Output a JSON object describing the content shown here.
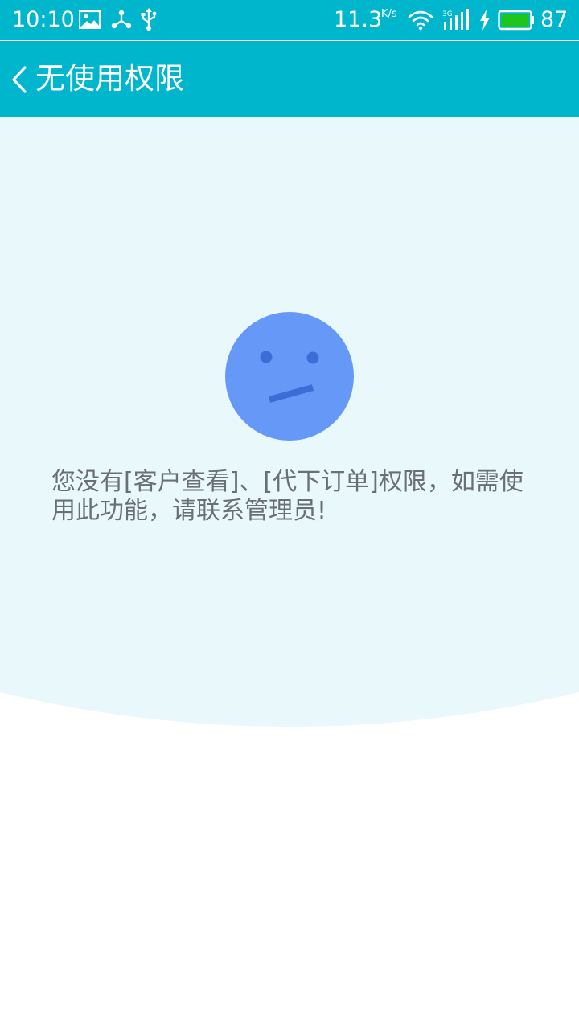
{
  "status_bar": {
    "time": "10:10",
    "net_speed": "11.3",
    "net_speed_unit": "K/s",
    "signal_type": "3G",
    "battery_level": "87",
    "icons": [
      "image-icon",
      "share-node-icon",
      "usb-icon",
      "wifi-icon",
      "signal-icon",
      "charging-icon",
      "battery-icon"
    ],
    "battery_color": "#1ec51e"
  },
  "header": {
    "back_icon": "chevron-left-icon",
    "title": "无使用权限"
  },
  "main": {
    "illustration": "neutral-face-icon",
    "message": "您没有[客户查看]、[代下订单]权限，如需使用此功能，请联系管理员!"
  },
  "colors": {
    "primary": "#00b6cd",
    "background_arc": "#e8f8fb",
    "face": "#6598f7",
    "face_features": "#3a6ed6",
    "message_text": "#6a6f73"
  }
}
